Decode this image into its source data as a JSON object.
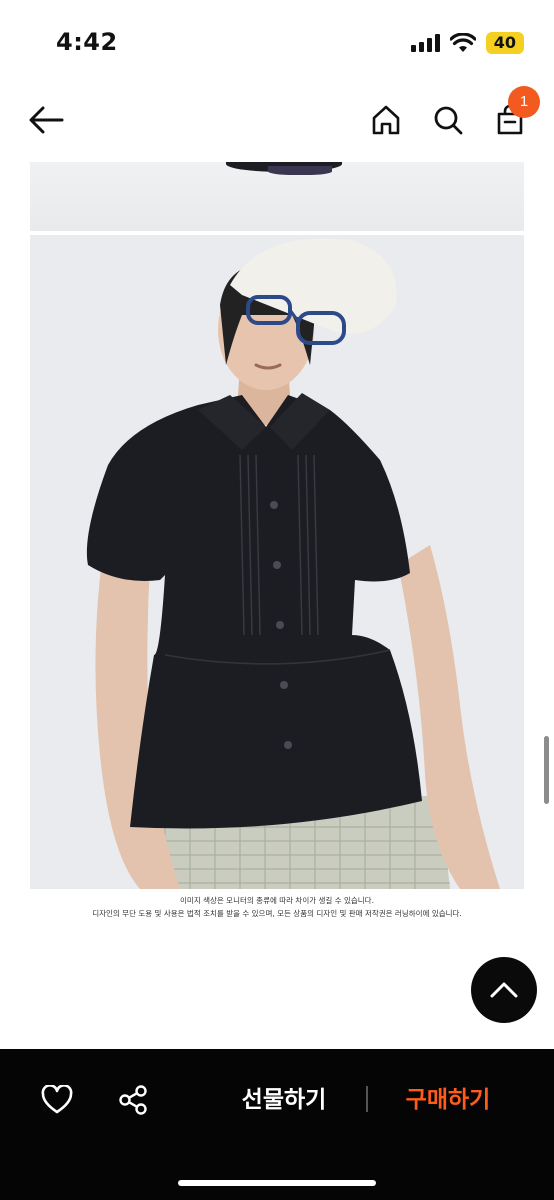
{
  "status_bar": {
    "time": "4:42",
    "battery": "40"
  },
  "nav": {
    "cart_count": "1"
  },
  "product_image": {
    "disclaimer_line1": "이미지 색상은 모니터의 종류에 따라 차이가 생길 수 있습니다.",
    "disclaimer_line2": "디자인의 무단 도용 및 사용은 법적 조치를 받을 수 있으며, 모든 상품의 디자인 및 판매 저작권은 러닝하이에 있습니다."
  },
  "bottom_bar": {
    "gift_label": "선물하기",
    "buy_label": "구매하기"
  },
  "colors": {
    "accent": "#ff5b1a",
    "badge": "#f25a1f",
    "battery": "#f5d020",
    "bottom_bar_bg": "#050505"
  },
  "icons": [
    "back-arrow-icon",
    "home-icon",
    "search-icon",
    "shopping-bag-icon",
    "heart-icon",
    "share-icon",
    "chevron-up-icon"
  ]
}
